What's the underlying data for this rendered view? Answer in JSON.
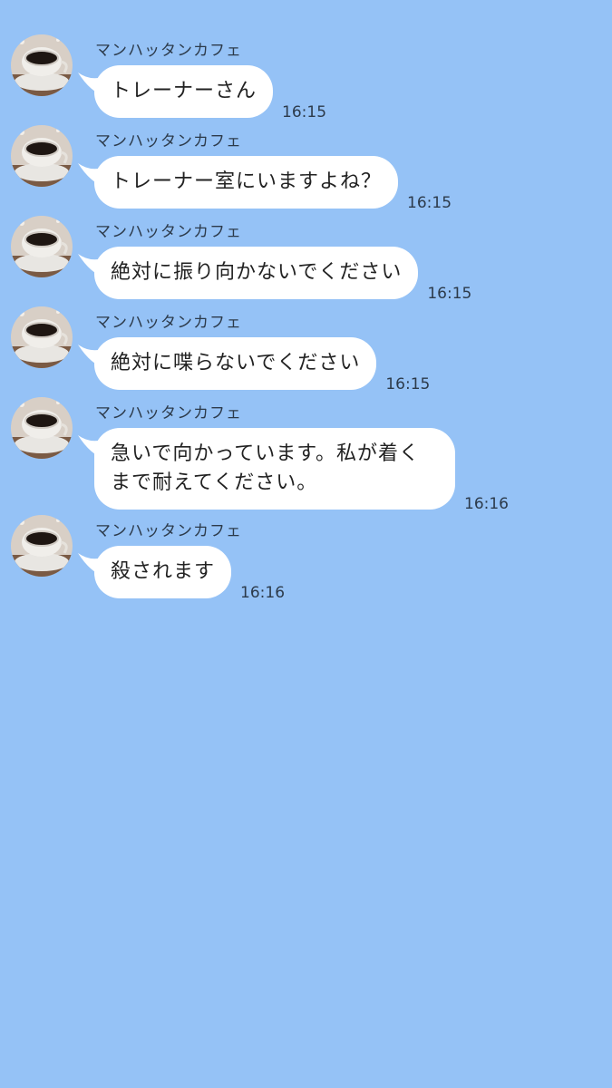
{
  "messages": [
    {
      "sender": "マンハッタンカフェ",
      "text": "トレーナーさん",
      "time": "16:15",
      "avatar": "coffee-cup"
    },
    {
      "sender": "マンハッタンカフェ",
      "text": "トレーナー室にいますよね？",
      "time": "16:15",
      "avatar": "coffee-cup"
    },
    {
      "sender": "マンハッタンカフェ",
      "text": "絶対に振り向かないでください",
      "time": "16:15",
      "avatar": "coffee-cup"
    },
    {
      "sender": "マンハッタンカフェ",
      "text": "絶対に喋らないでください",
      "time": "16:15",
      "avatar": "coffee-cup"
    },
    {
      "sender": "マンハッタンカフェ",
      "text": "急いで向かっています。私が着くまで耐えてください。",
      "time": "16:16",
      "avatar": "coffee-cup"
    },
    {
      "sender": "マンハッタンカフェ",
      "text": "殺されます",
      "time": "16:16",
      "avatar": "coffee-cup"
    }
  ],
  "colors": {
    "background": "#95c2f6",
    "bubble": "#ffffff",
    "text": "#222222"
  }
}
